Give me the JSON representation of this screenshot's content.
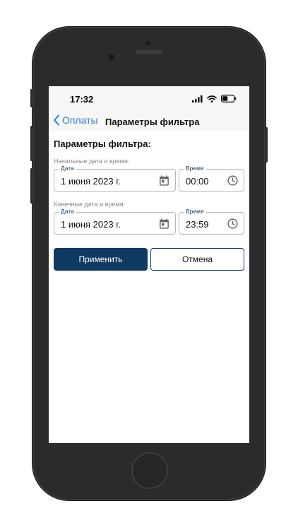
{
  "statusbar": {
    "time": "17:32"
  },
  "navbar": {
    "back_label": "Оплаты",
    "title": "Параметры фильтра"
  },
  "form": {
    "heading": "Параметры фильтра:",
    "start": {
      "section_label": "Начальные дата и время:",
      "date_label": "Дата",
      "date_value": "1 июня 2023 г.",
      "time_label": "Время",
      "time_value": "00:00"
    },
    "end": {
      "section_label": "Конечные дата и время:",
      "date_label": "Дата",
      "date_value": "1 июня 2023 г.",
      "time_label": "Время",
      "time_value": "23:59"
    }
  },
  "buttons": {
    "apply_label": "Применить",
    "cancel_label": "Отмена"
  },
  "icons": {
    "back": "chevron-left-icon",
    "date": "calendar-icon",
    "time": "clock-icon",
    "signal": "signal-icon",
    "wifi": "wifi-icon",
    "battery": "battery-icon"
  },
  "colors": {
    "accent": "#2f7de0",
    "primary": "#0f3a62",
    "field_label": "#0c3a66"
  }
}
